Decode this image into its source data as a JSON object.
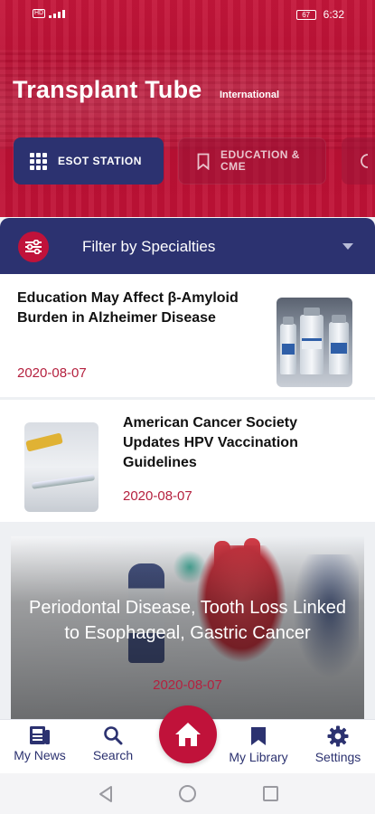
{
  "status_bar": {
    "network_label": "Volte",
    "battery_level": "67",
    "time": "6:32"
  },
  "header": {
    "title": "Transplant Tube",
    "subtitle": "International"
  },
  "chips": [
    {
      "label": "ESOT STATION",
      "icon": "grid-icon",
      "active": true
    },
    {
      "label": "EDUCATION & CME",
      "icon": "bookmark-icon",
      "active": false
    }
  ],
  "filter": {
    "label": "Filter by Specialties",
    "icon": "sliders-icon"
  },
  "articles": [
    {
      "title": "Education May Affect β-Amyloid Burden in Alzheimer Disease",
      "date": "2020-08-07"
    },
    {
      "title": "American Cancer Society Updates HPV Vaccination Guidelines",
      "date": "2020-08-07"
    },
    {
      "title": "Periodontal Disease, Tooth Loss Linked to Esophageal, Gastric Cancer",
      "date": "2020-08-07"
    }
  ],
  "bottom_nav": {
    "my_news": "My News",
    "search": "Search",
    "my_library": "My Library",
    "settings": "Settings"
  },
  "colors": {
    "brand_red": "#c0123a",
    "brand_navy": "#2c3270",
    "date_red": "#b5213f"
  }
}
